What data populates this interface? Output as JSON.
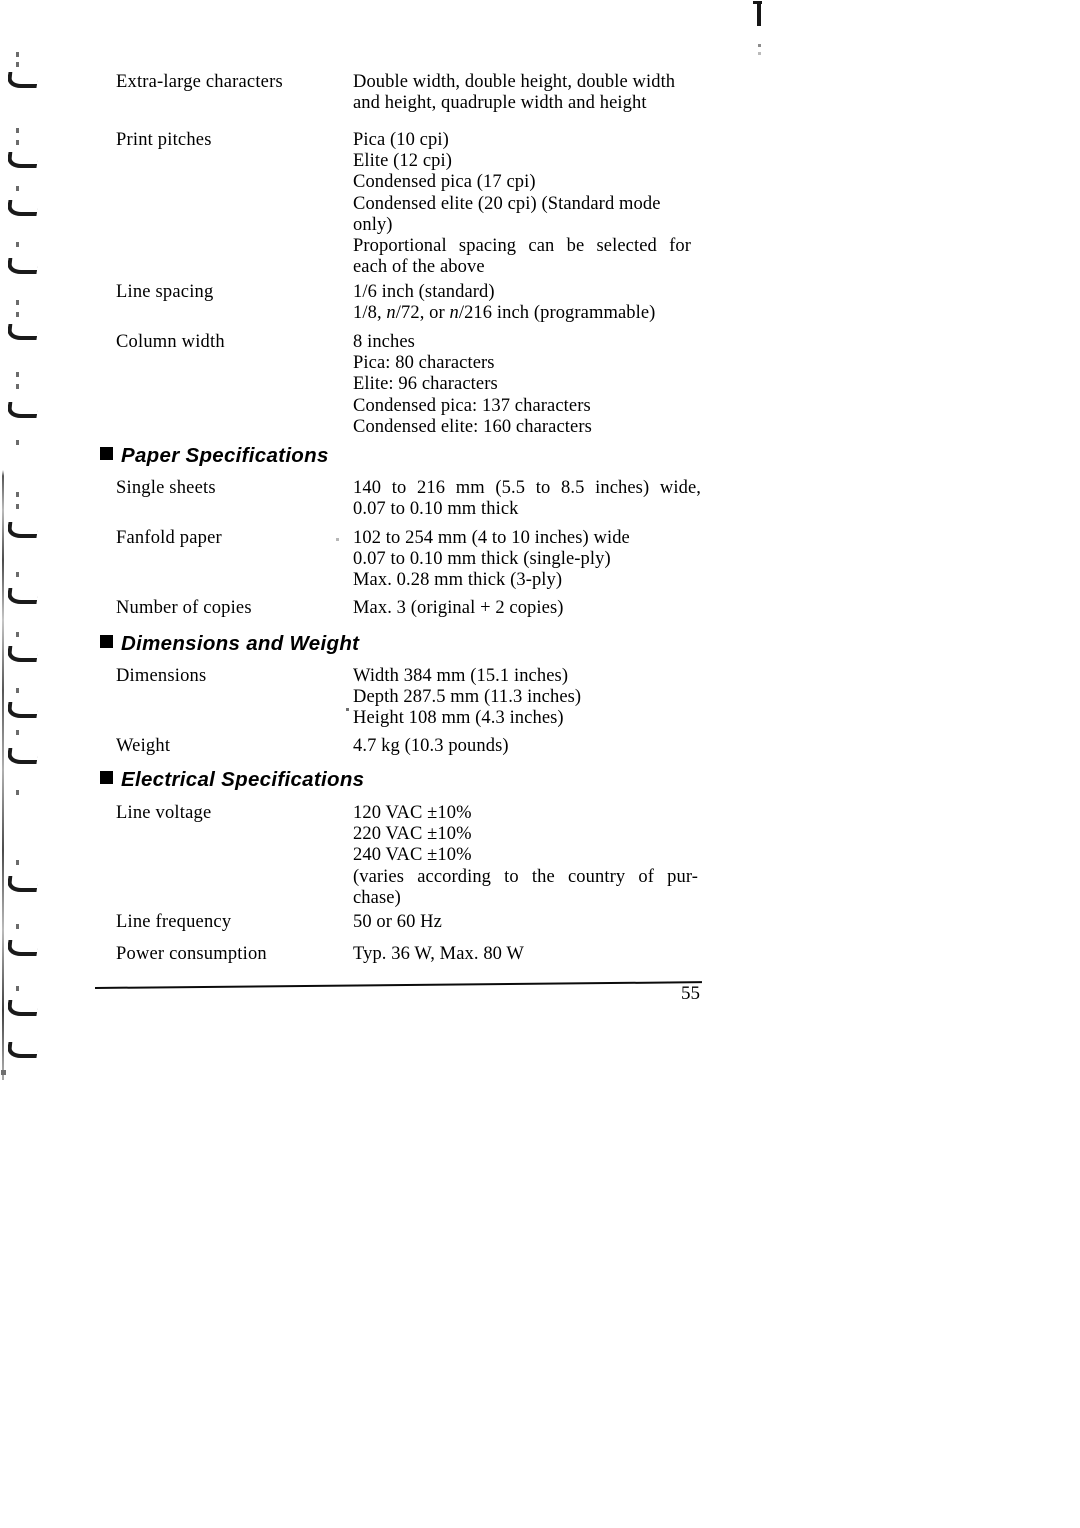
{
  "document": {
    "page_number": "55",
    "sections": [
      {
        "id": "continued-specs",
        "heading": null,
        "rows": [
          {
            "label": "Extra-large characters",
            "value_lines": [
              "Double width, double height, double width",
              "and height, quadruple width and height"
            ]
          },
          {
            "label": "Print pitches",
            "value_lines": [
              "Pica (10 cpi)",
              "Elite (12 cpi)",
              "Condensed pica (17 cpi)",
              "Condensed elite (20 cpi) (Standard mode",
              "only)",
              "Proportional spacing can be selected for",
              "each of the above"
            ]
          },
          {
            "label": "Line spacing",
            "value_lines": [
              "1/6 inch (standard)",
              "1/8, n/72, or n/216 inch (programmable)"
            ]
          },
          {
            "label": "Column width",
            "value_lines": [
              "8 inches",
              "Pica: 80 characters",
              "Elite:  96 characters",
              "Condensed pica:  137 characters",
              "Condensed elite:  160 characters"
            ]
          }
        ]
      },
      {
        "id": "paper-specifications",
        "heading": "Paper Specifications",
        "rows": [
          {
            "label": "Single sheets",
            "value_lines": [
              "140 to 216 mm (5.5 to 8.5 inches) wide,",
              "0.07 to 0.10 mm thick"
            ]
          },
          {
            "label": "Fanfold paper",
            "value_lines": [
              "102 to 254 mm (4 to 10 inches) wide",
              "0.07 to 0.10 mm thick (single-ply)",
              "Max. 0.28 mm thick (3-ply)"
            ]
          },
          {
            "label": "Number of copies",
            "value_lines": [
              "Max. 3 (original + 2 copies)"
            ]
          }
        ]
      },
      {
        "id": "dimensions-and-weight",
        "heading": "Dimensions and Weight",
        "rows": [
          {
            "label": "Dimensions",
            "value_lines": [
              "Width 384 mm (15.1 inches)",
              "Depth 287.5 mm (11.3 inches)",
              "Height 108 mm (4.3 inches)"
            ]
          },
          {
            "label": "Weight",
            "value_lines": [
              "4.7 kg (10.3 pounds)"
            ]
          }
        ]
      },
      {
        "id": "electrical-specifications",
        "heading": "Electrical Specifications",
        "rows": [
          {
            "label": "Line voltage",
            "value_lines": [
              "120 VAC ±10%",
              "220 VAC ±10%",
              "240 VAC ±10%",
              "(varies according to the country of pur-",
              "chase)"
            ]
          },
          {
            "label": "Line frequency",
            "value_lines": [
              "50 or 60 Hz"
            ]
          },
          {
            "label": "Power consumption",
            "value_lines": [
              "Typ. 36 W, Max. 80 W"
            ]
          }
        ]
      }
    ]
  },
  "rows_flat": {
    "r0": {
      "label": "Extra-large characters"
    },
    "r1": {
      "label": "Print pitches"
    },
    "r2": {
      "label": "Line spacing"
    },
    "r3": {
      "label": "Column width"
    },
    "r4": {
      "label": "Single sheets"
    },
    "r5": {
      "label": "Fanfold paper"
    },
    "r6": {
      "label": "Number of copies"
    },
    "r7": {
      "label": "Dimensions"
    },
    "r8": {
      "label": "Weight"
    },
    "r9": {
      "label": "Line voltage"
    },
    "r10": {
      "label": "Line frequency"
    },
    "r11": {
      "label": "Power consumption"
    }
  },
  "values_flat": {
    "v0_l0": "Double width, double height, double width",
    "v0_l1": "and height, quadruple width and height",
    "v1_l0": "Pica (10 cpi)",
    "v1_l1": "Elite (12 cpi)",
    "v1_l2": "Condensed pica (17 cpi)",
    "v1_l3": "Condensed elite (20 cpi) (Standard mode",
    "v1_l4": "only)",
    "v1_l5": "Proportional spacing can be selected for",
    "v1_l6": "each of the above",
    "v2_l0": "1/6 inch (standard)",
    "v2_l1_a": "1/8, ",
    "v2_l1_n1": "n",
    "v2_l1_b": "/72, or ",
    "v2_l1_n2": "n",
    "v2_l1_c": "/216 inch (programmable)",
    "v3_l0": "8 inches",
    "v3_l1": "Pica: 80 characters",
    "v3_l2": "Elite:  96 characters",
    "v3_l3": "Condensed pica:  137 characters",
    "v3_l4": "Condensed elite:  160 characters",
    "v4_l0": "140 to 216 mm (5.5 to 8.5 inches) wide,",
    "v4_l1": "0.07 to 0.10 mm thick",
    "v5_l0": "102 to 254 mm (4 to 10 inches) wide",
    "v5_l1": "0.07 to 0.10 mm thick (single-ply)",
    "v5_l2": "Max. 0.28 mm thick (3-ply)",
    "v6_l0": "Max. 3 (original + 2 copies)",
    "v7_l0": "Width 384 mm (15.1 inches)",
    "v7_l1": "Depth 287.5 mm (11.3 inches)",
    "v7_l2": "Height 108 mm (4.3 inches)",
    "v8_l0": "4.7 kg (10.3 pounds)",
    "v9_l0": "120 VAC ±10%",
    "v9_l1": "220 VAC ±10%",
    "v9_l2": "240 VAC ±10%",
    "v9_l3": "(varies according to the country of pur-",
    "v9_l4": "chase)",
    "v10_l0": "50 or 60 Hz",
    "v11_l0": "Typ. 36 W, Max. 80 W"
  },
  "headings_flat": {
    "h_paper": "Paper Specifications",
    "h_dimensions": "Dimensions and Weight",
    "h_electrical": "Electrical Specifications"
  },
  "footer": {
    "page_number": "55"
  }
}
